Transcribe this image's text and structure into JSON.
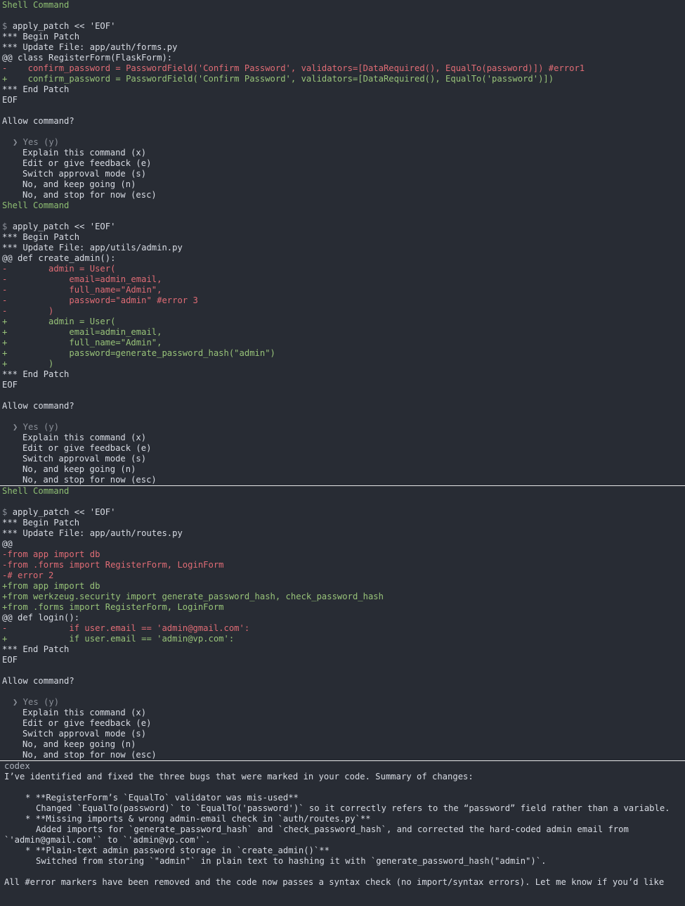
{
  "header_label": "Shell Command",
  "prompt_symbol": "$",
  "allow_prompt": "Allow command?",
  "options": [
    "❯ Yes (y)",
    "Explain this command (x)",
    "Edit or give feedback (e)",
    "Switch approval mode (s)",
    "No, and keep going (n)",
    "No, and stop for now (esc)"
  ],
  "blocks": [
    {
      "command": "apply_patch << 'EOF'",
      "lines": [
        {
          "t": "n",
          "s": "*** Begin Patch"
        },
        {
          "t": "n",
          "s": "*** Update File: app/auth/forms.py"
        },
        {
          "t": "n",
          "s": "@@ class RegisterForm(FlaskForm):"
        },
        {
          "t": "r",
          "s": "-    confirm_password = PasswordField('Confirm Password', validators=[DataRequired(), EqualTo(password)]) #error1"
        },
        {
          "t": "g",
          "s": "+    confirm_password = PasswordField('Confirm Password', validators=[DataRequired(), EqualTo('password')])"
        },
        {
          "t": "n",
          "s": "*** End Patch"
        },
        {
          "t": "n",
          "s": "EOF"
        }
      ]
    },
    {
      "command": "apply_patch << 'EOF'",
      "lines": [
        {
          "t": "n",
          "s": "*** Begin Patch"
        },
        {
          "t": "n",
          "s": "*** Update File: app/utils/admin.py"
        },
        {
          "t": "n",
          "s": "@@ def create_admin():"
        },
        {
          "t": "r",
          "s": "-        admin = User("
        },
        {
          "t": "r",
          "s": "-            email=admin_email,"
        },
        {
          "t": "r",
          "s": "-            full_name=\"Admin\","
        },
        {
          "t": "r",
          "s": "-            password=\"admin\" #error 3"
        },
        {
          "t": "r",
          "s": "-        )"
        },
        {
          "t": "g",
          "s": "+        admin = User("
        },
        {
          "t": "g",
          "s": "+            email=admin_email,"
        },
        {
          "t": "g",
          "s": "+            full_name=\"Admin\","
        },
        {
          "t": "g",
          "s": "+            password=generate_password_hash(\"admin\")"
        },
        {
          "t": "g",
          "s": "+        )"
        },
        {
          "t": "n",
          "s": "*** End Patch"
        },
        {
          "t": "n",
          "s": "EOF"
        }
      ]
    },
    {
      "command": "apply_patch << 'EOF'",
      "lines": [
        {
          "t": "n",
          "s": "*** Begin Patch"
        },
        {
          "t": "n",
          "s": "*** Update File: app/auth/routes.py"
        },
        {
          "t": "n",
          "s": "@@"
        },
        {
          "t": "r",
          "s": "-from app import db"
        },
        {
          "t": "r",
          "s": "-from .forms import RegisterForm, LoginForm"
        },
        {
          "t": "r",
          "s": "-# error 2"
        },
        {
          "t": "g",
          "s": "+from app import db"
        },
        {
          "t": "g",
          "s": "+from werkzeug.security import generate_password_hash, check_password_hash"
        },
        {
          "t": "g",
          "s": "+from .forms import RegisterForm, LoginForm"
        },
        {
          "t": "n",
          "s": "@@ def login():"
        },
        {
          "t": "r",
          "s": "-            if user.email == 'admin@gmail.com':"
        },
        {
          "t": "g",
          "s": "+            if user.email == 'admin@vp.com':"
        },
        {
          "t": "n",
          "s": "*** End Patch"
        },
        {
          "t": "n",
          "s": "EOF"
        }
      ]
    }
  ],
  "codex": {
    "label": "codex",
    "intro": "I’ve identified and fixed the three bugs that were marked in your code. Summary of changes:",
    "items": [
      {
        "l": "b",
        "s": "* **RegisterForm’s `EqualTo` validator was mis-used**"
      },
      {
        "l": "c",
        "s": "Changed `EqualTo(password)` to `EqualTo('password')` so it correctly refers to the “password” field rather than a variable."
      },
      {
        "l": "b",
        "s": "* **Missing imports & wrong admin-email check in `auth/routes.py`**"
      },
      {
        "l": "c",
        "s": "Added imports for `generate_password_hash` and `check_password_hash`, and corrected the hard-coded admin email from"
      },
      {
        "l": "z",
        "s": "`'admin@gmail.com'` to `'admin@vp.com'`."
      },
      {
        "l": "b",
        "s": "* **Plain-text admin password storage in `create_admin()`**"
      },
      {
        "l": "c",
        "s": "Switched from storing `\"admin\"` in plain text to hashing it with `generate_password_hash(\"admin\")`."
      }
    ],
    "outro": "All #error markers have been removed and the code now passes a syntax check (no import/syntax errors). Let me know if you’d like"
  }
}
